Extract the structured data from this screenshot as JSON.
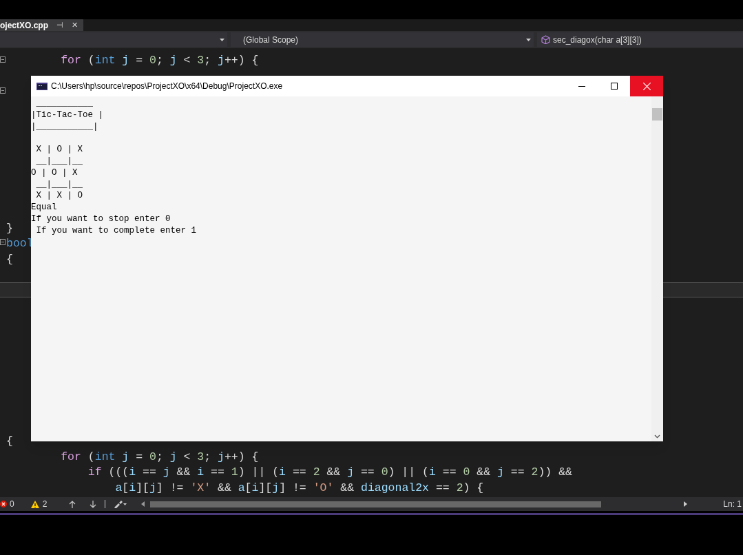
{
  "editor_tab": {
    "label": "ojectXO.cpp",
    "pin": "⊣",
    "close": "✕"
  },
  "navigation_bar": {
    "scope": "(Global Scope)",
    "member": "sec_diagox(char a[3][3])"
  },
  "top_pane": {
    "lines_top": [
      [
        {
          "text": "        for",
          "kind": "control"
        },
        {
          "text": " ("
        },
        {
          "text": "int",
          "kind": "type"
        },
        {
          "text": " j",
          "kind": "var"
        },
        {
          "text": " = "
        },
        {
          "text": "0",
          "kind": "number"
        },
        {
          "text": "; "
        },
        {
          "text": "j",
          "kind": "var"
        },
        {
          "text": " < "
        },
        {
          "text": "3",
          "kind": "number"
        },
        {
          "text": "; "
        },
        {
          "text": "j",
          "kind": "var"
        },
        {
          "text": "++) {"
        }
      ]
    ],
    "lines_bottom": [
      [
        {
          "text": "}"
        }
      ],
      [
        {
          "text": "bool",
          "kind": "type"
        }
      ],
      [
        {
          "text": "{"
        }
      ]
    ]
  },
  "bottom_pane": {
    "lines": [
      [
        {
          "text": "{"
        }
      ],
      [
        {
          "text": "        for",
          "kind": "control"
        },
        {
          "text": " ("
        },
        {
          "text": "int",
          "kind": "type"
        },
        {
          "text": " j",
          "kind": "var"
        },
        {
          "text": " = "
        },
        {
          "text": "0",
          "kind": "number"
        },
        {
          "text": "; "
        },
        {
          "text": "j",
          "kind": "var"
        },
        {
          "text": " < "
        },
        {
          "text": "3",
          "kind": "number"
        },
        {
          "text": "; "
        },
        {
          "text": "j",
          "kind": "var"
        },
        {
          "text": "++) {"
        }
      ],
      [
        {
          "text": "            if",
          "kind": "control"
        },
        {
          "text": " ((("
        },
        {
          "text": "i",
          "kind": "var"
        },
        {
          "text": " == "
        },
        {
          "text": "j",
          "kind": "var"
        },
        {
          "text": " && "
        },
        {
          "text": "i",
          "kind": "var"
        },
        {
          "text": " == "
        },
        {
          "text": "1",
          "kind": "number"
        },
        {
          "text": ") || ("
        },
        {
          "text": "i",
          "kind": "var"
        },
        {
          "text": " == "
        },
        {
          "text": "2",
          "kind": "number"
        },
        {
          "text": " && "
        },
        {
          "text": "j",
          "kind": "var"
        },
        {
          "text": " == "
        },
        {
          "text": "0",
          "kind": "number"
        },
        {
          "text": ") || ("
        },
        {
          "text": "i",
          "kind": "var"
        },
        {
          "text": " == "
        },
        {
          "text": "0",
          "kind": "number"
        },
        {
          "text": " && "
        },
        {
          "text": "j",
          "kind": "var"
        },
        {
          "text": " == "
        },
        {
          "text": "2",
          "kind": "number"
        },
        {
          "text": ")) &&"
        }
      ],
      [
        {
          "text": "                a",
          "kind": "var"
        },
        {
          "text": "["
        },
        {
          "text": "i",
          "kind": "var"
        },
        {
          "text": "]["
        },
        {
          "text": "j",
          "kind": "var"
        },
        {
          "text": "] != "
        },
        {
          "text": "'X'",
          "kind": "string"
        },
        {
          "text": " && "
        },
        {
          "text": "a",
          "kind": "var"
        },
        {
          "text": "["
        },
        {
          "text": "i",
          "kind": "var"
        },
        {
          "text": "]["
        },
        {
          "text": "j",
          "kind": "var"
        },
        {
          "text": "] != "
        },
        {
          "text": "'O'",
          "kind": "string"
        },
        {
          "text": " && "
        },
        {
          "text": "diagonal2x",
          "kind": "var"
        },
        {
          "text": " == "
        },
        {
          "text": "2",
          "kind": "number"
        },
        {
          "text": ") {"
        }
      ]
    ]
  },
  "console": {
    "title": "C:\\Users\\hp\\source\\repos\\ProjectXO\\x64\\Debug\\ProjectXO.exe",
    "header_lines": [
      " ___________",
      "|Tic-Tac-Toe |",
      "|___________|"
    ],
    "board_lines": [
      " X | O | X",
      " __|___|__",
      "O | O | X",
      " __|___|__",
      " X | X | O"
    ],
    "message_lines": [
      "Equal",
      "If you want to stop enter 0",
      " If you want to complete enter 1"
    ]
  },
  "status_bar": {
    "errors": "0",
    "warnings": "2",
    "position": "Ln: 1"
  }
}
